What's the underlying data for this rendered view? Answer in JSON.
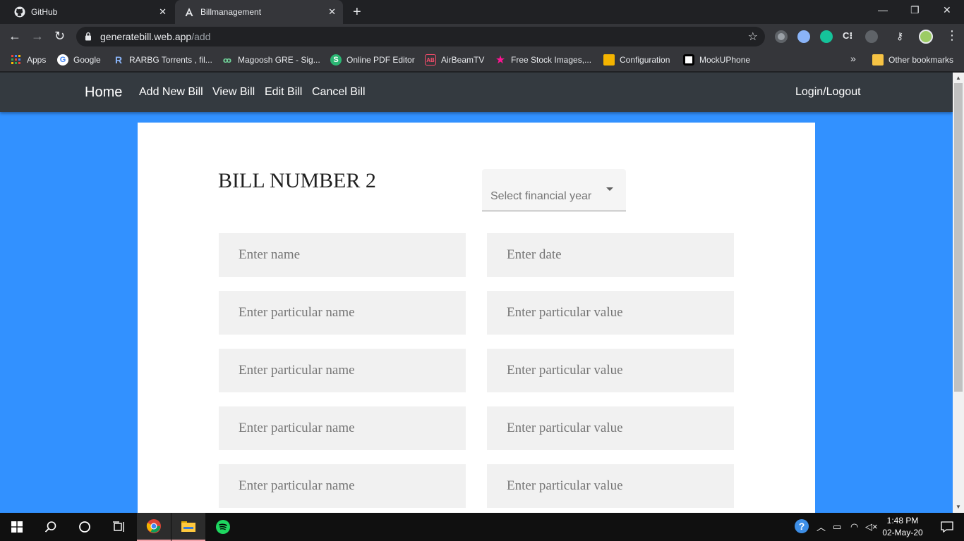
{
  "browser": {
    "tabs": [
      {
        "label": "GitHub",
        "icon": "github-icon"
      },
      {
        "label": "Billmanagement",
        "icon": "angular-icon"
      }
    ],
    "url_host": "generatebill.web.app",
    "url_path": "/add",
    "bookmarks": [
      {
        "label": "Apps",
        "icon": "apps-grid-icon"
      },
      {
        "label": "Google",
        "icon": "google-icon"
      },
      {
        "label": "RARBG Torrents , fil...",
        "icon": "rarbg-icon"
      },
      {
        "label": "Magoosh GRE - Sig...",
        "icon": "magoosh-icon"
      },
      {
        "label": "Online PDF Editor",
        "icon": "sejda-icon"
      },
      {
        "label": "AirBeamTV",
        "icon": "airbeamtv-icon"
      },
      {
        "label": "Free Stock Images,...",
        "icon": "star-icon"
      },
      {
        "label": "Configuration",
        "icon": "box-icon"
      },
      {
        "label": "MockUPhone",
        "icon": "mockuphone-icon"
      }
    ],
    "bookmarks_overflow": "»",
    "other_bookmarks": "Other bookmarks"
  },
  "app": {
    "nav": {
      "brand": "Home",
      "links": [
        "Add New Bill",
        "View Bill",
        "Edit Bill",
        "Cancel Bill"
      ],
      "login": "Login/Logout"
    },
    "form": {
      "title": "BILL NUMBER 2",
      "financial_year_placeholder": "Select financial year",
      "name_placeholder": "Enter name",
      "date_placeholder": "Enter date",
      "particular_name_placeholder": "Enter particular name",
      "particular_value_placeholder": "Enter particular value"
    }
  },
  "taskbar": {
    "time": "1:48 PM",
    "date": "02-May-20"
  },
  "colors": {
    "page_background": "#3291ff",
    "navbar": "#343a40",
    "input_background": "#f1f1f1"
  }
}
